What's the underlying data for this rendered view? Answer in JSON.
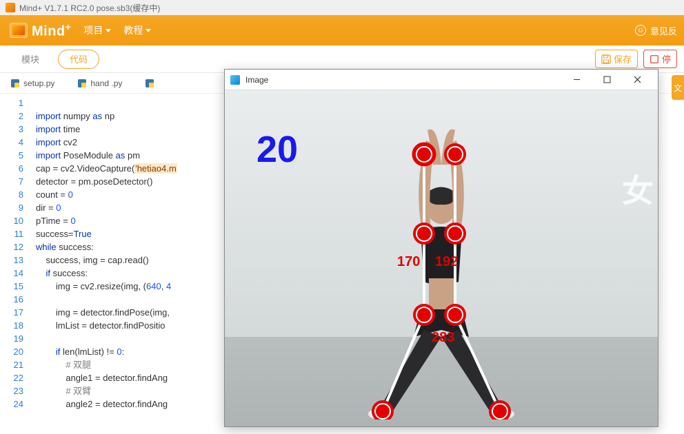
{
  "window": {
    "title": "Mind+ V1.7.1 RC2.0     pose.sb3(缓存中)"
  },
  "ribbon": {
    "logo": "Mind",
    "logo_sup": "+",
    "project": "项目",
    "tutorial": "教程",
    "feedback": "意见反"
  },
  "subbar": {
    "module": "模块",
    "code": "代码",
    "save": "保存",
    "stop": "停"
  },
  "side_tab": "文",
  "tabs": [
    {
      "label": "setup.py"
    },
    {
      "label": "hand .py"
    }
  ],
  "code_lines": [
    "",
    "import numpy as np",
    "import time",
    "import cv2",
    "import PoseModule as pm",
    "cap = cv2.VideoCapture('hetiao4.m",
    "detector = pm.poseDetector()",
    "count = 0",
    "dir = 0",
    "pTime = 0",
    "success=True",
    "while success:",
    "    success, img = cap.read()",
    "    if success:",
    "        img = cv2.resize(img, (640, 4",
    "",
    "        img = detector.findPose(img,",
    "        lmList = detector.findPositio",
    "",
    "        if len(lmList) != 0:",
    "            # 双腿",
    "            angle1 = detector.findAng",
    "            # 双臂",
    "            angle2 = detector.findAng"
  ],
  "image_window": {
    "title": "Image",
    "counter": "20",
    "angle_left_shoulder": "170",
    "angle_right_shoulder": "192",
    "angle_hip": "283",
    "watermark": "女"
  }
}
